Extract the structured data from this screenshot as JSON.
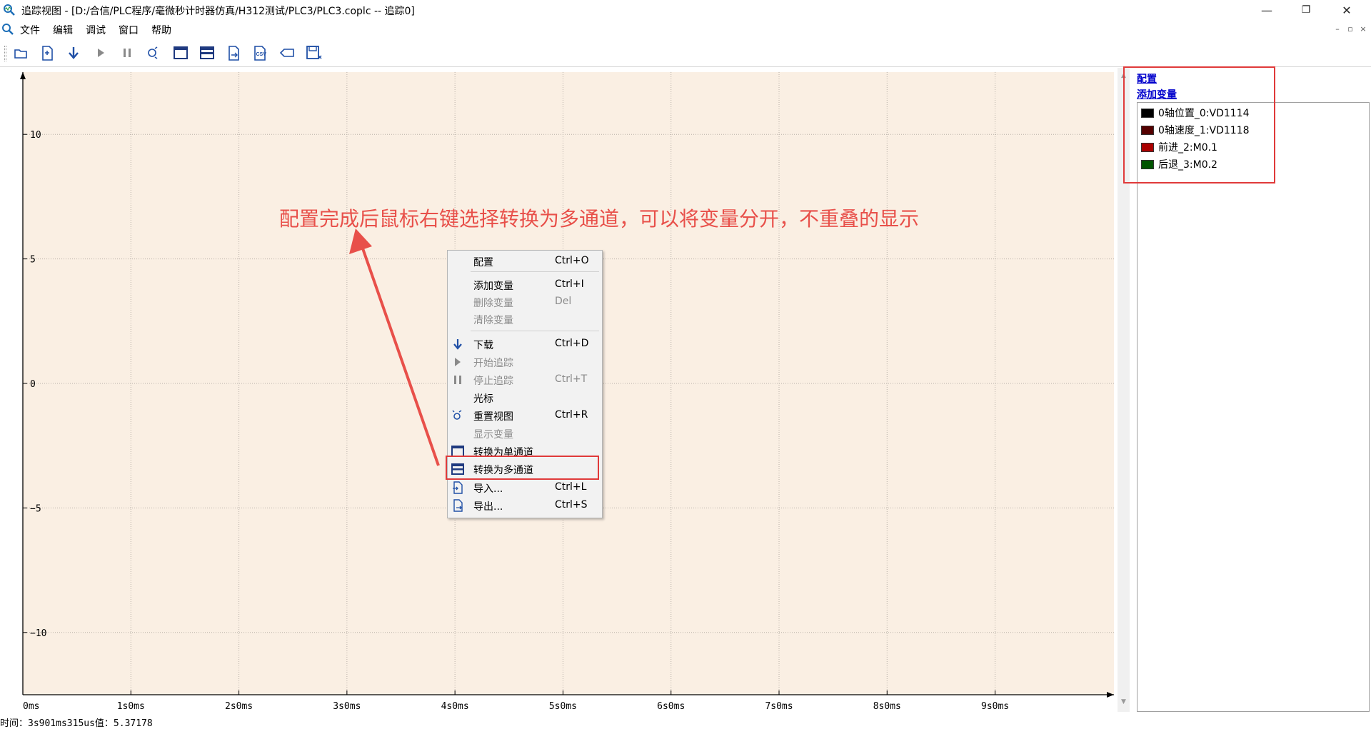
{
  "window": {
    "title": "追踪视图 - [D:/合信/PLC程序/毫微秒计时器仿真/H312测试/PLC3/PLC3.coplc -- 追踪0]",
    "minimize": "—",
    "restore": "❐",
    "close": "✕"
  },
  "menu": {
    "items": [
      "文件",
      "编辑",
      "调试",
      "窗口",
      "帮助"
    ],
    "mdi_controls": [
      "–",
      "▫",
      "×"
    ]
  },
  "toolbar": {
    "buttons": [
      "open-icon",
      "new-file-icon",
      "download-icon",
      "start-icon",
      "pause-icon",
      "reset-view-icon",
      "single-channel-icon",
      "multi-channel-icon",
      "export-icon",
      "csv-icon",
      "tag-icon",
      "save-snapshot-icon"
    ],
    "csv_text": "CSV"
  },
  "chart_data": {
    "type": "line",
    "series": [],
    "y_tick_labels": [
      "10",
      "5",
      "0",
      "−5",
      "−10"
    ],
    "y_ticks": [
      10,
      5,
      0,
      -5,
      -10
    ],
    "ylim": [
      -12.5,
      12.5
    ],
    "x_tick_labels": [
      "0ms",
      "1s0ms",
      "2s0ms",
      "3s0ms",
      "4s0ms",
      "5s0ms",
      "6s0ms",
      "7s0ms",
      "8s0ms",
      "9s0ms"
    ],
    "x_ticks": [
      0,
      1,
      2,
      3,
      4,
      5,
      6,
      7,
      8,
      9
    ],
    "xlim": [
      0,
      10.1
    ],
    "grid": true,
    "background": "#faefe3",
    "grid_color": "#b8b0a8"
  },
  "right_panel": {
    "config_link": "配置",
    "add_var_link": "添加变量",
    "variables": [
      {
        "label": "0轴位置_0:VD1114",
        "color": "#000000"
      },
      {
        "label": "0轴速度_1:VD1118",
        "color": "#550000"
      },
      {
        "label": "前进_2:M0.1",
        "color": "#aa0000"
      },
      {
        "label": "后退_3:M0.2",
        "color": "#005500"
      }
    ]
  },
  "annotation": {
    "text": "配置完成后鼠标右键选择转换为多通道，可以将变量分开，不重叠的显示",
    "color": "#e8504a"
  },
  "context_menu": {
    "items": [
      {
        "label": "配置",
        "shortcut": "Ctrl+O",
        "icon": "",
        "disabled": false
      },
      {
        "label": "添加变量",
        "shortcut": "Ctrl+I",
        "icon": "",
        "disabled": false
      },
      {
        "label": "删除变量",
        "shortcut": "Del",
        "icon": "",
        "disabled": true
      },
      {
        "label": "清除变量",
        "shortcut": "",
        "icon": "",
        "disabled": true
      },
      {
        "label": "下载",
        "shortcut": "Ctrl+D",
        "icon": "download-icon",
        "disabled": false
      },
      {
        "label": "开始追踪",
        "shortcut": "",
        "icon": "play-icon",
        "disabled": true
      },
      {
        "label": "停止追踪",
        "shortcut": "Ctrl+T",
        "icon": "pause-icon",
        "disabled": true
      },
      {
        "label": "光标",
        "shortcut": "",
        "icon": "",
        "disabled": false
      },
      {
        "label": "重置视图",
        "shortcut": "Ctrl+R",
        "icon": "reset-view-icon",
        "disabled": false
      },
      {
        "label": "显示变量",
        "shortcut": "",
        "icon": "",
        "disabled": true
      },
      {
        "label": "转换为单通道",
        "shortcut": "",
        "icon": "single-channel-icon",
        "disabled": false
      },
      {
        "label": "转换为多通道",
        "shortcut": "",
        "icon": "multi-channel-icon",
        "disabled": false
      },
      {
        "label": "导入...",
        "shortcut": "Ctrl+L",
        "icon": "import-icon",
        "disabled": false
      },
      {
        "label": "导出...",
        "shortcut": "Ctrl+S",
        "icon": "export-icon",
        "disabled": false
      }
    ]
  },
  "status": {
    "text": "时间：3s901ms315us值：5.37178"
  }
}
